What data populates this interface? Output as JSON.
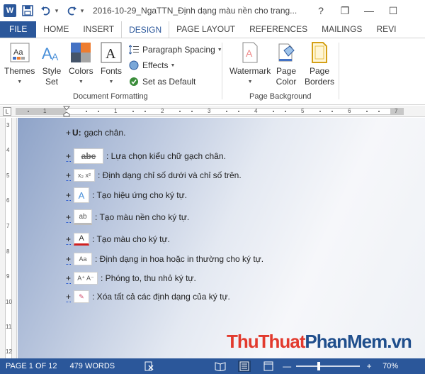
{
  "titlebar": {
    "title": "2016-10-29_NgaTTN_Định dạng màu nền cho trang...",
    "help": "?",
    "restore": "❐",
    "minimize": "—",
    "maximize": "☐"
  },
  "tabs": [
    {
      "label": "FILE"
    },
    {
      "label": "HOME"
    },
    {
      "label": "INSERT"
    },
    {
      "label": "DESIGN"
    },
    {
      "label": "PAGE LAYOUT"
    },
    {
      "label": "REFERENCES"
    },
    {
      "label": "MAILINGS"
    },
    {
      "label": "REVI"
    }
  ],
  "ribbon": {
    "themes": {
      "label": "Themes"
    },
    "style_set": {
      "label_line1": "Style",
      "label_line2": "Set"
    },
    "colors": {
      "label": "Colors"
    },
    "fonts": {
      "label": "Fonts"
    },
    "paragraph_spacing": {
      "label": "Paragraph Spacing"
    },
    "effects": {
      "label": "Effects"
    },
    "set_default": {
      "label": "Set as Default"
    },
    "group_document": "Document Formatting",
    "watermark": {
      "label": "Watermark"
    },
    "page_color": {
      "label_line1": "Page",
      "label_line2": "Color"
    },
    "page_borders": {
      "label_line1": "Page",
      "label_line2": "Borders"
    },
    "group_background": "Page Background"
  },
  "ruler": {
    "numbers": [
      "1",
      "1",
      "2",
      "3",
      "4",
      "5",
      "6",
      "7"
    ]
  },
  "vruler": {
    "numbers": [
      "3",
      "4",
      "5",
      "6",
      "7",
      "8",
      "9",
      "10",
      "11",
      "12"
    ]
  },
  "document": {
    "lines": [
      {
        "prefix": "+",
        "bold": "U:",
        "text": "gạch chân."
      },
      {
        "prefix": "+",
        "button": "abc",
        "text": ": Lựa chọn kiểu chữ gạch chân."
      },
      {
        "prefix": "+",
        "button": "x₂ x²",
        "text": ": Định dạng chỉ số dưới và chỉ số trên."
      },
      {
        "prefix": "+",
        "button": "A",
        "text": ": Tạo hiệu ứng cho ký tự."
      },
      {
        "prefix": "+",
        "button": "ab",
        "text": ": Tạo màu nền cho ký tự."
      },
      {
        "prefix": "+",
        "button": "A",
        "text": ": Tạo màu cho ký tự."
      },
      {
        "prefix": "+",
        "button": "Aa",
        "text": ": Định dạng in hoa hoặc in thường cho ký tự."
      },
      {
        "prefix": "+",
        "button": "A⁺ A⁻",
        "text": ": Phóng to, thu nhỏ ký tự."
      },
      {
        "prefix": "+",
        "button": "✎",
        "text": ": Xóa tất cả các định dạng của ký tự."
      }
    ]
  },
  "watermark_text": {
    "part1": "Thu",
    "part2": "Thuat",
    "part3": "Phan",
    "part4": "Mem",
    "part5": ".vn"
  },
  "statusbar": {
    "page": "PAGE 1 OF 12",
    "words": "479 WORDS",
    "zoom": "70%",
    "zoom_level": 0.7
  },
  "colors": {
    "accent": "#2b579a"
  }
}
